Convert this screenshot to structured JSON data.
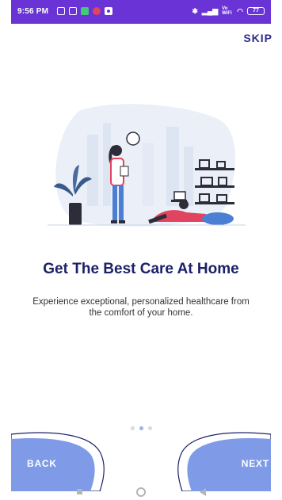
{
  "status_bar": {
    "time": "9:56 PM",
    "signal_text": "Vo WiFi",
    "battery": "77"
  },
  "onboarding": {
    "skip_label": "SKIP",
    "headline": "Get The Best Care At Home",
    "subtitle": "Experience exceptional, personalized healthcare from the comfort of your home.",
    "page_count": 3,
    "active_page": 2,
    "back_label": "BACK",
    "next_label": "NEXT"
  },
  "colors": {
    "status_bar": "#6a33d6",
    "headline": "#1b2069",
    "accent": "#7f9be8",
    "dot_active": "#9fb0e8",
    "dot_inactive": "#d9d9e2"
  }
}
